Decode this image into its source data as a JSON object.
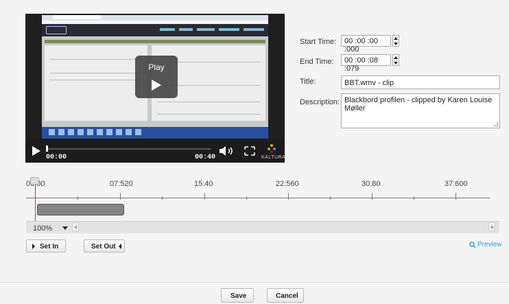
{
  "player": {
    "overlay_play_label": "Play",
    "current_time": "00:00",
    "duration": "00:40",
    "brand": "KALTURA",
    "progress": 0
  },
  "form": {
    "start_time_label": "Start Time:",
    "start_time_value": "00 :00 :00 :000",
    "end_time_label": "End Time:",
    "end_time_value": "00 :00 :08 :079",
    "title_label": "Title:",
    "title_value": "BBT.wmv - clip",
    "description_label": "Description:",
    "description_value": "Blackbord profilen - clipped by Karen Louise Møller"
  },
  "timeline": {
    "ticks": [
      "00:00",
      "07:520",
      "15:40",
      "22:560",
      "30:80",
      "37:600"
    ],
    "zoom": "100%",
    "playhead_color": "#c0392b"
  },
  "buttons": {
    "set_in": "Set In",
    "set_out": "Set Out",
    "preview": "Preview",
    "save": "Save",
    "cancel": "Cancel"
  }
}
